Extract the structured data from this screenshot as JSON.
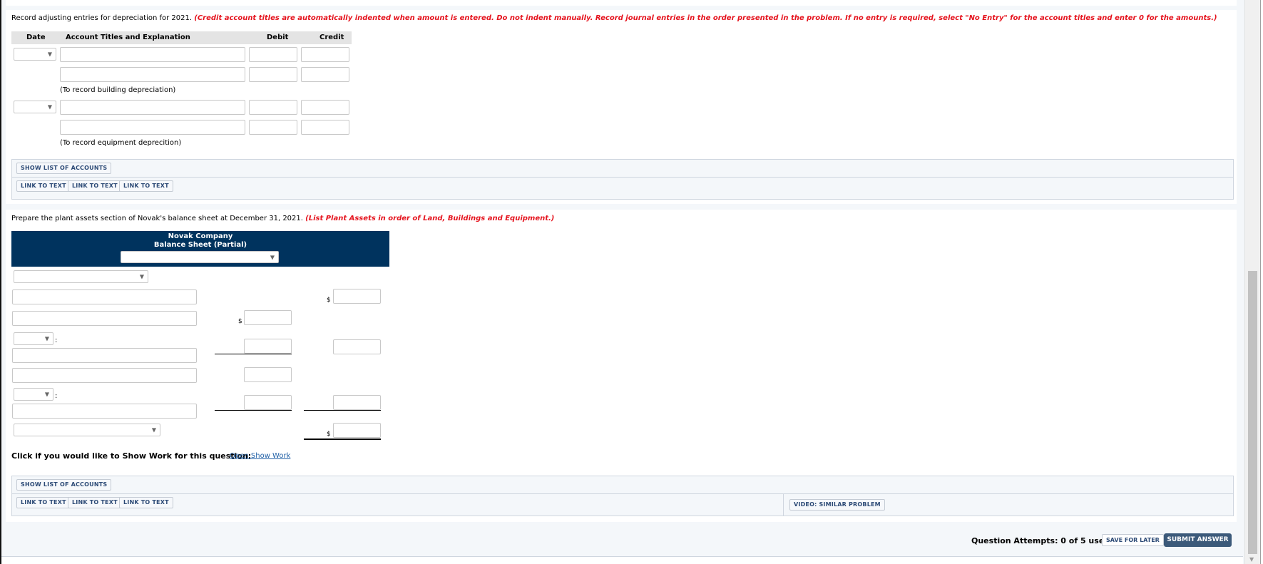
{
  "part1": {
    "instruction": "Record adjusting entries for depreciation for 2021.",
    "instruction_note": "(Credit account titles are automatically indented when amount is entered. Do not indent manually. Record journal entries in the order presented in the problem. If no entry is required, select \"No Entry\" for the account titles and enter 0 for the amounts.)",
    "table_headers": {
      "date": "Date",
      "account": "Account Titles and Explanation",
      "debit": "Debit",
      "credit": "Credit"
    },
    "entries": [
      {
        "date": "",
        "lines": [
          {
            "account": "",
            "debit": "",
            "credit": ""
          },
          {
            "account": "",
            "debit": "",
            "credit": ""
          }
        ],
        "explanation": "(To record building depreciation)"
      },
      {
        "date": "",
        "lines": [
          {
            "account": "",
            "debit": "",
            "credit": ""
          },
          {
            "account": "",
            "debit": "",
            "credit": ""
          }
        ],
        "explanation": "(To record equipment deprecition)"
      }
    ],
    "buttons": {
      "show_accounts": "SHOW LIST OF ACCOUNTS",
      "links": [
        "LINK TO TEXT",
        "LINK TO TEXT",
        "LINK TO TEXT"
      ]
    }
  },
  "part2": {
    "instruction": "Prepare the plant assets section of Novak's balance sheet at December 31, 2021.",
    "instruction_note": "(List Plant Assets in order of Land, Buildings and Equipment.)",
    "sheet": {
      "company": "Novak Company",
      "title": "Balance Sheet (Partial)",
      "date_select": "",
      "section_select": "",
      "rows": {
        "land_label": "",
        "land_amount": "",
        "buildings_label": "",
        "buildings_amount": "",
        "less1_select": "",
        "accum1_label": "",
        "accum1_amount": "",
        "net1_amount": "",
        "equipment_label": "",
        "equipment_amount": "",
        "less2_select": "",
        "accum2_label": "",
        "accum2_amount": "",
        "net2_amount": "",
        "total_select": "",
        "total_amount": ""
      },
      "currency_symbol": "$",
      "colon": ":"
    },
    "show_work_prompt": "Click if you would like to Show Work for this question:",
    "show_work_link": "Open Show Work",
    "buttons": {
      "show_accounts": "SHOW LIST OF ACCOUNTS",
      "links": [
        "LINK TO TEXT",
        "LINK TO TEXT",
        "LINK TO TEXT"
      ],
      "video": "VIDEO: SIMILAR PROBLEM"
    }
  },
  "footer": {
    "attempts": "Question Attempts: 0 of 5 used",
    "save_label": "SAVE FOR LATER",
    "submit_label": "SUBMIT ANSWER"
  },
  "icons": {
    "dropdown_arrow": "▼",
    "scroll_down": "▼"
  },
  "colors": {
    "instruction_red": "#e5141e",
    "header_navy": "#00335e",
    "submit_bg": "#3c5a7a",
    "button_text": "#2c4a76"
  }
}
